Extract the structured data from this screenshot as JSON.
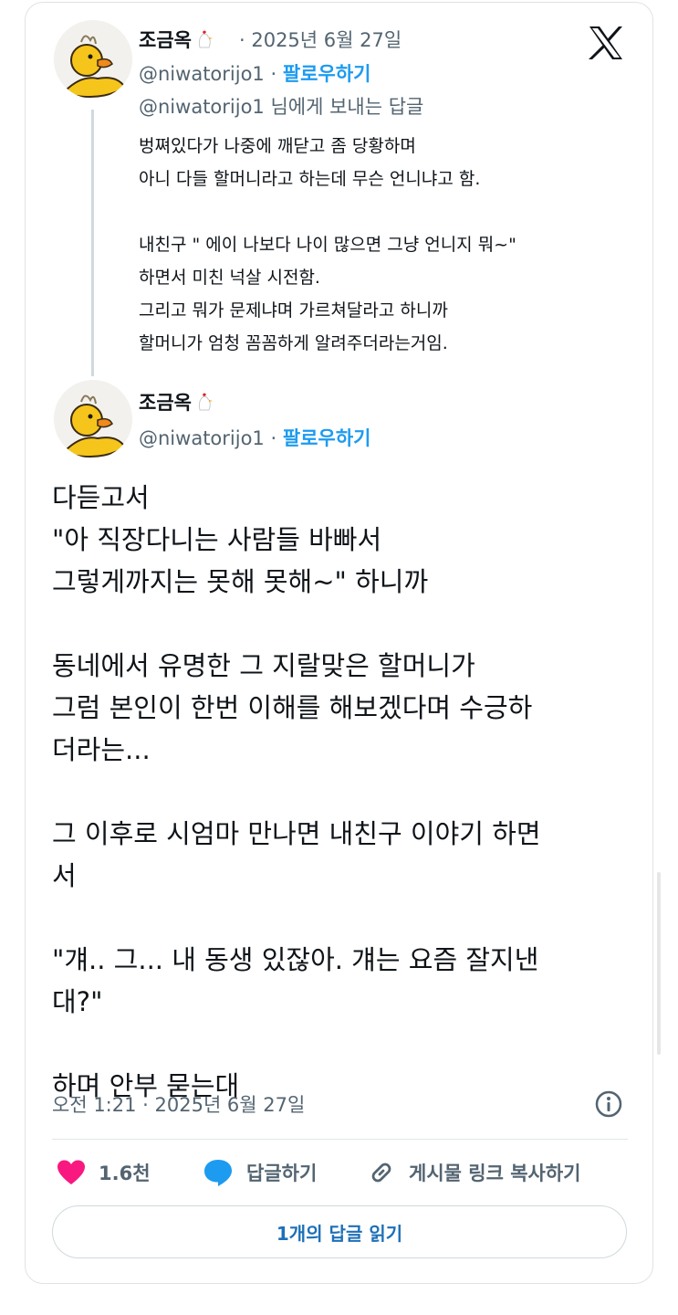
{
  "reply_tweet": {
    "author_name": "조금옥",
    "date": "· 2025년 6월 27일",
    "handle": "@niwatorijo1",
    "separator": "·",
    "follow_label": "팔로우하기",
    "replying_to": "@niwatorijo1 님에게 보내는 답글",
    "text": "벙쪄있다가 나중에 깨닫고 좀 당황하며\n아니 다들 할머니라고 하는데 무슨 언니냐고 함.\n\n내친구 \" 에이 나보다 나이 많으면 그냥 언니지 뭐~\"\n하면서 미친 넉살 시전함.\n그리고 뭐가 문제냐며 가르쳐달라고 하니까\n할머니가 엄청 꼼꼼하게 알려주더라는거임."
  },
  "main_tweet": {
    "author_name": "조금옥",
    "handle": "@niwatorijo1",
    "separator": "·",
    "follow_label": "팔로우하기",
    "text": "다듣고서\n\"아 직장다니는 사람들 바빠서\n  그렇게까지는 못해 못해~\" 하니까\n\n동네에서 유명한 그 지랄맞은 할머니가\n그럼 본인이 한번 이해를 해보겠다며 수긍하\n더라는...\n\n그 이후로 시엄마 만나면 내친구 이야기 하면\n서\n\n\"걔.. 그... 내 동생 있잖아. 걔는 요즘 잘지낸\n대?\"\n\n하며 안부 묻는대",
    "timestamp": "오전 1:21 · 2025년 6월 27일"
  },
  "actions": {
    "like_count": "1.6천",
    "reply_label": "답글하기",
    "copy_link_label": "게시물 링크 복사하기"
  },
  "read_replies_label": "1개의 답글 읽기",
  "icons": {
    "logo": "x-logo-icon",
    "author_badge": "chicken-emoji-icon",
    "like": "heart-icon",
    "reply": "speech-bubble-icon",
    "copy_link": "link-icon",
    "info": "info-icon"
  },
  "colors": {
    "like": "#f91880",
    "reply": "#1d9bf0",
    "follow": "#1d9bf0",
    "secondary_text": "#536471"
  }
}
